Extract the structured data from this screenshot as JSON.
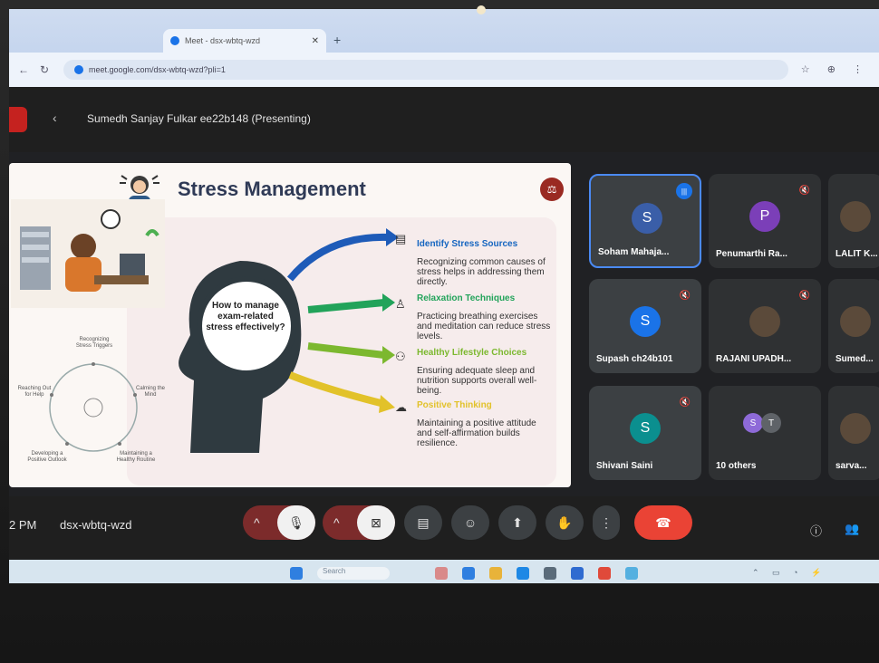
{
  "browser": {
    "tab_title": "Meet - dsx-wbtq-wzd",
    "url": "meet.google.com/dsx-wbtq-wzd?pli=1"
  },
  "meet": {
    "presenter_label": "Sumedh Sanjay Fulkar ee22b148 (Presenting)",
    "meeting_code": "dsx-wbtq-wzd",
    "time": "2 PM"
  },
  "slide": {
    "title": "Stress Management",
    "question": "How to manage exam-related stress effectively?",
    "points": [
      {
        "heading": "Identify Stress Sources",
        "color": "#1565c0",
        "text": "Recognizing common causes of stress helps in addressing them directly."
      },
      {
        "heading": "Relaxation Techniques",
        "color": "#22a35a",
        "text": "Practicing breathing exercises and meditation can reduce stress levels."
      },
      {
        "heading": "Healthy Lifestyle Choices",
        "color": "#7cb82f",
        "text": "Ensuring adequate sleep and nutrition supports overall well-being."
      },
      {
        "heading": "Positive Thinking",
        "color": "#e2c22a",
        "text": "Maintaining a positive attitude and self-affirmation builds resilience."
      }
    ],
    "cycle_labels": [
      "Recognizing Stress Triggers",
      "Calming the Mind",
      "Maintaining a Healthy Routine",
      "Developing a Positive Outlook",
      "Reaching Out for Help"
    ]
  },
  "participants": [
    {
      "initial": "S",
      "name": "Soham Mahaja...",
      "color": "#3a5ea8",
      "speaking": true
    },
    {
      "initial": "P",
      "name": "Penumarthi Ra...",
      "color": "#7b3fb8",
      "muted": true
    },
    {
      "initial": "",
      "name": "LALIT K..."
    },
    {
      "initial": "S",
      "name": "Supash ch24b101",
      "color": "#1a73e8",
      "muted": true
    },
    {
      "initial": "",
      "name": "RAJANI UPADH...",
      "muted": true
    },
    {
      "initial": "",
      "name": "Sumed..."
    },
    {
      "initial": "S",
      "name": "Shivani Saini",
      "color": "#0b8f8f",
      "muted": true
    },
    {
      "initial": "",
      "name": "10 others",
      "mini": [
        "S",
        "T"
      ]
    },
    {
      "initial": "",
      "name": "sarva..."
    }
  ],
  "controls": {
    "mic_icon": "mic-off-icon",
    "cam_icon": "camera-off-icon",
    "end_icon": "call-end-icon"
  }
}
